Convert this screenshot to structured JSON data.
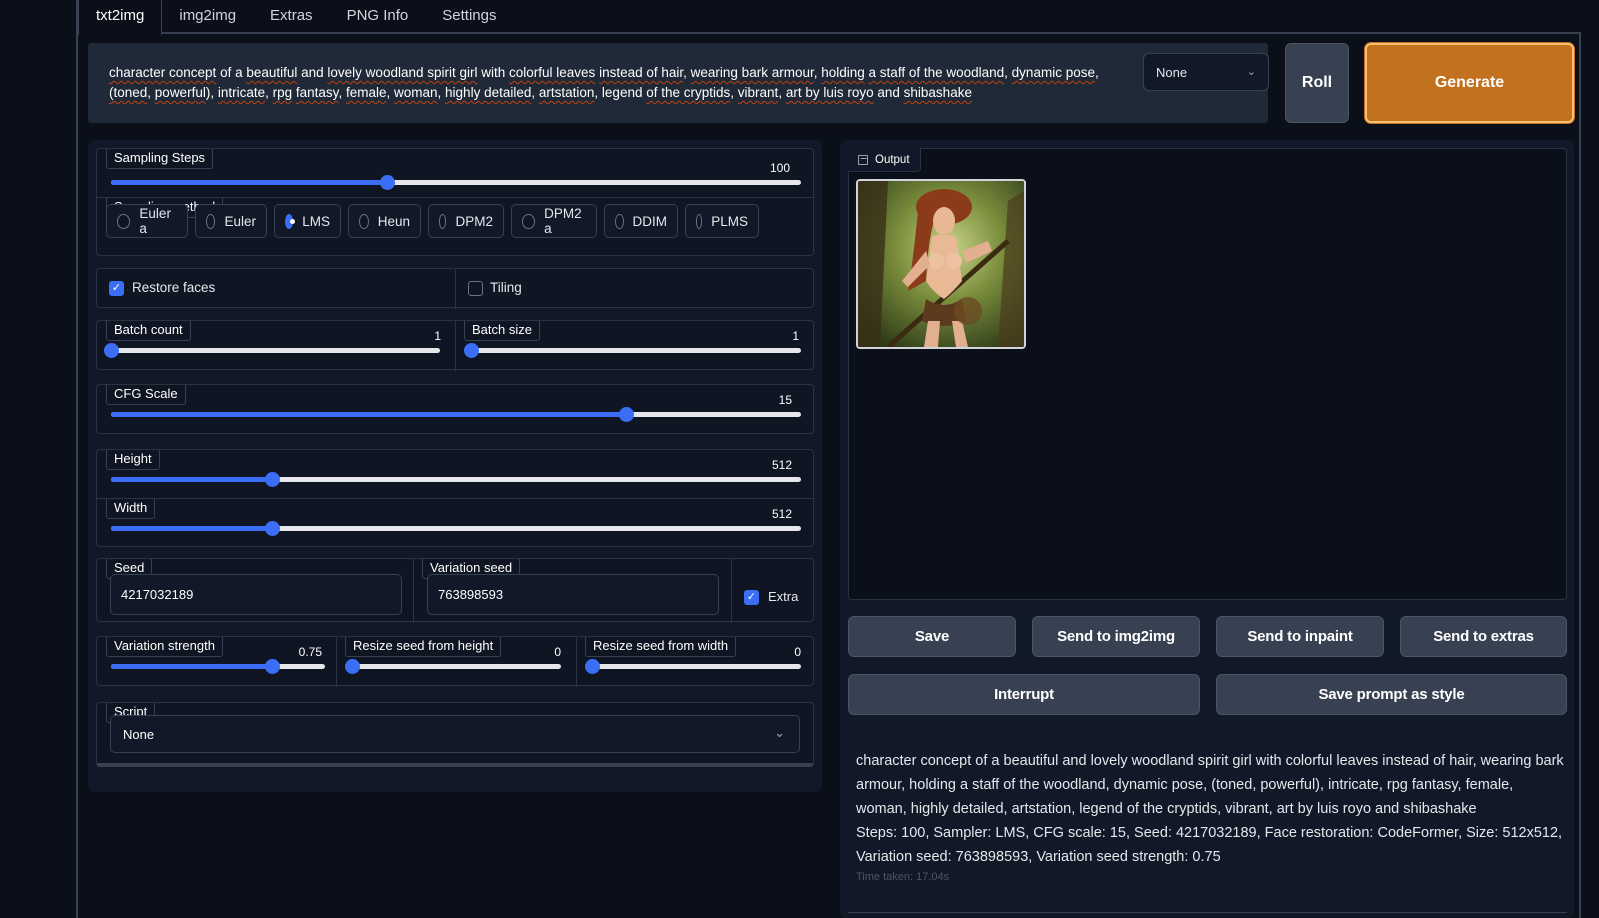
{
  "tabs": [
    "txt2img",
    "img2img",
    "Extras",
    "PNG Info",
    "Settings"
  ],
  "prompt": {
    "segments": [
      {
        "t": "character concept",
        "u": true
      },
      {
        "t": " of a ",
        "u": false
      },
      {
        "t": "beautiful",
        "u": true
      },
      {
        "t": " and ",
        "u": false
      },
      {
        "t": "lovely woodland spirit girl",
        "u": true
      },
      {
        "t": " with ",
        "u": false
      },
      {
        "t": "colorful leaves",
        "u": true
      },
      {
        "t": " ",
        "u": false
      },
      {
        "t": "instead of hair",
        "u": true
      },
      {
        "t": ", ",
        "u": false
      },
      {
        "t": "wearing bark armour",
        "u": true
      },
      {
        "t": ",  ",
        "u": false
      },
      {
        "t": "holding",
        "u": true
      },
      {
        "t": " ",
        "u": false
      },
      {
        "t": "a staff of the woodland",
        "u": true
      },
      {
        "t": ", ",
        "u": false
      },
      {
        "t": "dynamic pose",
        "u": true
      },
      {
        "t": ", ",
        "u": false
      },
      {
        "t": "(toned",
        "u": true
      },
      {
        "t": ", ",
        "u": false
      },
      {
        "t": "powerful",
        "u": true
      },
      {
        "t": "), ",
        "u": false
      },
      {
        "t": "intricate",
        "u": true
      },
      {
        "t": ", ",
        "u": false
      },
      {
        "t": "rpg",
        "u": true
      },
      {
        "t": "  ",
        "u": false
      },
      {
        "t": "fantasy",
        "u": true
      },
      {
        "t": ", ",
        "u": false
      },
      {
        "t": "female",
        "u": true
      },
      {
        "t": ", ",
        "u": false
      },
      {
        "t": "woman",
        "u": true
      },
      {
        "t": ",  ",
        "u": false
      },
      {
        "t": "highly detailed",
        "u": true
      },
      {
        "t": ", ",
        "u": false
      },
      {
        "t": "artstation",
        "u": true
      },
      {
        "t": ", legend ",
        "u": false
      },
      {
        "t": "of the cryptids",
        "u": true
      },
      {
        "t": ", ",
        "u": false
      },
      {
        "t": "vibrant",
        "u": true
      },
      {
        "t": ",  ",
        "u": false
      },
      {
        "t": "art by luis royo",
        "u": true
      },
      {
        "t": " and ",
        "u": false
      },
      {
        "t": "shibashake",
        "u": true
      }
    ]
  },
  "style_select": {
    "value": "None"
  },
  "roll_label": "Roll",
  "generate_label": "Generate",
  "sampling_steps": {
    "label": "Sampling Steps",
    "value": "100",
    "fraction": 0.4
  },
  "sampling_method": {
    "label": "Sampling method",
    "options": [
      "Euler a",
      "Euler",
      "LMS",
      "Heun",
      "DPM2",
      "DPM2 a",
      "DDIM",
      "PLMS"
    ],
    "selected": "LMS"
  },
  "restore_faces": {
    "label": "Restore faces",
    "checked": true
  },
  "tiling": {
    "label": "Tiling",
    "checked": false
  },
  "batch_count": {
    "label": "Batch count",
    "value": "1",
    "fraction": 0
  },
  "batch_size": {
    "label": "Batch size",
    "value": "1",
    "fraction": 0
  },
  "cfg_scale": {
    "label": "CFG Scale",
    "value": "15",
    "fraction": 0.747
  },
  "height": {
    "label": "Height",
    "value": "512",
    "fraction": 0.233
  },
  "width": {
    "label": "Width",
    "value": "512",
    "fraction": 0.233
  },
  "seed": {
    "label": "Seed",
    "value": "4217032189"
  },
  "variation_seed": {
    "label": "Variation seed",
    "value": "763898593"
  },
  "extra": {
    "label": "Extra",
    "checked": true
  },
  "variation_strength": {
    "label": "Variation strength",
    "value": "0.75",
    "fraction": 0.75
  },
  "resize_seed_height": {
    "label": "Resize seed from height",
    "value": "0",
    "fraction": 0
  },
  "resize_seed_width": {
    "label": "Resize seed from width",
    "value": "0",
    "fraction": 0
  },
  "script": {
    "label": "Script",
    "value": "None"
  },
  "output": {
    "label": "Output"
  },
  "buttons": {
    "save": "Save",
    "send_img2img": "Send to img2img",
    "send_inpaint": "Send to inpaint",
    "send_extras": "Send to extras",
    "interrupt": "Interrupt",
    "save_style": "Save prompt as style"
  },
  "generation_info": {
    "prompt": "character concept of a beautiful and lovely woodland spirit girl with colorful leaves instead of hair, wearing bark armour, holding a staff of the woodland, dynamic pose, (toned, powerful), intricate, rpg fantasy, female, woman, highly detailed, artstation, legend of the cryptids, vibrant, art by luis royo and shibashake",
    "params": "Steps: 100, Sampler: LMS, CFG scale: 15, Seed: 4217032189, Face restoration: CodeFormer, Size: 512x512, Variation seed: 763898593, Variation seed strength: 0.75",
    "time": "Time taken: 17.04s"
  },
  "colors": {
    "accent": "#3b6ef5",
    "generate": "#c2711f",
    "bg": "#0b0f19",
    "panel": "#111827"
  }
}
